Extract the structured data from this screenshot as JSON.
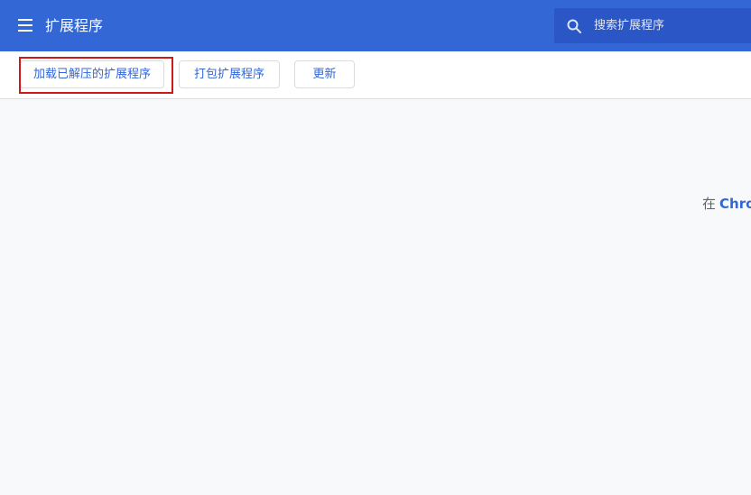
{
  "header": {
    "title": "扩展程序",
    "menu_icon": "hamburger-menu-icon",
    "search": {
      "placeholder": "搜索扩展程序",
      "value": "",
      "icon": "search-icon"
    }
  },
  "toolbar": {
    "load_unpacked_label": "加载已解压的扩展程序",
    "pack_label": "打包扩展程序",
    "update_label": "更新"
  },
  "content": {
    "promo_prefix": "在",
    "promo_link": "Chro"
  },
  "colors": {
    "header_bg": "#3367d6",
    "search_bg": "#2a56c6",
    "accent": "#3367d6",
    "page_bg": "#f8f9fa",
    "highlight": "#cc1919"
  }
}
